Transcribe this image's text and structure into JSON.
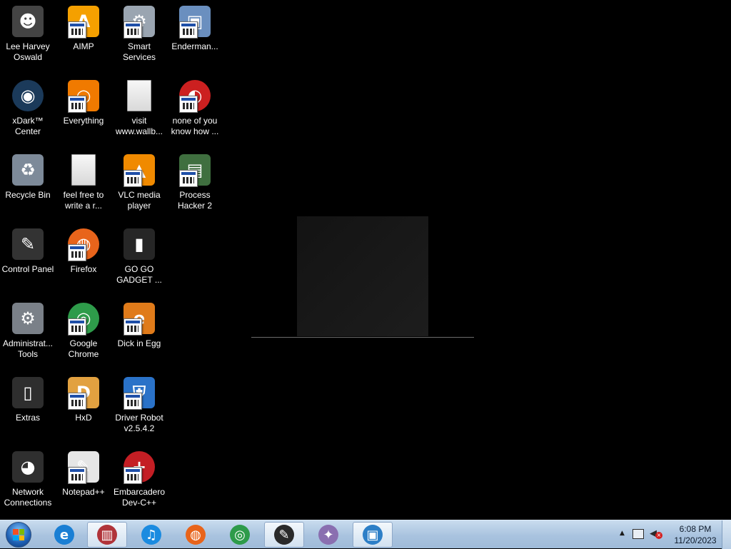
{
  "desktop": {
    "icons": [
      {
        "label": "Lee Harvey\nOswald",
        "icon": "person-icon",
        "color": "#444444",
        "glyph": "☻",
        "shortcut": false
      },
      {
        "label": "AIMP",
        "icon": "aimp-icon",
        "color": "#f5a000",
        "glyph": "A",
        "shortcut": true
      },
      {
        "label": "Smart\nServices",
        "icon": "gear-icon",
        "color": "#9aa5b1",
        "glyph": "⚙",
        "shortcut": true
      },
      {
        "label": "Enderman...",
        "icon": "window-app-icon",
        "color": "#6a8fbf",
        "glyph": "▣",
        "shortcut": true
      },
      {
        "label": "xDark™\nCenter",
        "icon": "xdark-icon",
        "color": "#1b3a5a",
        "glyph": "◉",
        "shortcut": false
      },
      {
        "label": "Everything",
        "icon": "search-icon",
        "color": "#f07a00",
        "glyph": "○",
        "shortcut": true
      },
      {
        "label": "visit\nwww.wallb...",
        "icon": "text-file-icon",
        "color": "#e6e6e6",
        "glyph": "",
        "shortcut": false
      },
      {
        "label": "none of you\nknow how ...",
        "icon": "red-app-icon",
        "color": "#cc2020",
        "glyph": "◐",
        "shortcut": true
      },
      {
        "label": "Recycle Bin",
        "icon": "recycle-bin-icon",
        "color": "#7d8a99",
        "glyph": "♻",
        "shortcut": false
      },
      {
        "label": "feel free to\nwrite a r...",
        "icon": "text-file-icon",
        "color": "#e6e6e6",
        "glyph": "",
        "shortcut": false
      },
      {
        "label": "VLC media\nplayer",
        "icon": "vlc-icon",
        "color": "#f08a00",
        "glyph": "▲",
        "shortcut": true
      },
      {
        "label": "Process\nHacker 2",
        "icon": "monitor-icon",
        "color": "#3f6f3f",
        "glyph": "▤",
        "shortcut": true
      },
      {
        "label": "Control Panel",
        "icon": "control-panel-icon",
        "color": "#333333",
        "glyph": "✎",
        "shortcut": false
      },
      {
        "label": "Firefox",
        "icon": "firefox-icon",
        "color": "#e8641b",
        "glyph": "◍",
        "shortcut": true
      },
      {
        "label": "GO GO\nGADGET ...",
        "icon": "gadget-icon",
        "color": "#262626",
        "glyph": "▮",
        "shortcut": false
      },
      null,
      {
        "label": "Administrat...\nTools",
        "icon": "tools-icon",
        "color": "#7a8088",
        "glyph": "⚙",
        "shortcut": false
      },
      {
        "label": "Google\nChrome",
        "icon": "chrome-icon",
        "color": "#2e9b4a",
        "glyph": "◎",
        "shortcut": true
      },
      {
        "label": "Dick in Egg",
        "icon": "egg-app-icon",
        "color": "#e07b1a",
        "glyph": "e",
        "shortcut": true
      },
      null,
      {
        "label": "Extras",
        "icon": "folder-icon",
        "color": "#2e2e2e",
        "glyph": "▯",
        "shortcut": false
      },
      {
        "label": "HxD",
        "icon": "hxd-icon",
        "color": "#e2a140",
        "glyph": "D",
        "shortcut": true
      },
      {
        "label": "Driver Robot\nv2.5.4.2",
        "icon": "driver-robot-icon",
        "color": "#2a72c8",
        "glyph": "⛨",
        "shortcut": true
      },
      null,
      {
        "label": "Network\nConnections",
        "icon": "network-icon",
        "color": "#2f2f2f",
        "glyph": "◕",
        "shortcut": false
      },
      {
        "label": "Notepad++",
        "icon": "notepad-icon",
        "color": "#e6e6e6",
        "glyph": "✎",
        "shortcut": true
      },
      {
        "label": "Embarcadero\nDev-C++",
        "icon": "devcpp-icon",
        "color": "#c41e24",
        "glyph": "+",
        "shortcut": true
      },
      null
    ]
  },
  "taskbar": {
    "pinned": [
      {
        "icon": "internet-explorer-icon",
        "color": "#1a7fd4",
        "glyph": "e",
        "active": false
      },
      {
        "icon": "archive-app-icon",
        "color": "#b0343a",
        "glyph": "▥",
        "active": true
      },
      {
        "icon": "music-player-icon",
        "color": "#1b8be0",
        "glyph": "♫",
        "active": false
      },
      {
        "icon": "firefox-icon",
        "color": "#e8641b",
        "glyph": "◍",
        "active": false
      },
      {
        "icon": "chrome-icon",
        "color": "#2e9b4a",
        "glyph": "◎",
        "active": false
      },
      {
        "icon": "control-panel-icon",
        "color": "#2a2a2a",
        "glyph": "✎",
        "active": true
      },
      {
        "icon": "paint-icon",
        "color": "#8a6fb0",
        "glyph": "✦",
        "active": false
      },
      {
        "icon": "photo-viewer-icon",
        "color": "#2d7fc7",
        "glyph": "▣",
        "active": true
      }
    ],
    "clock": {
      "time": "6:08 PM",
      "date": "11/20/2023"
    }
  }
}
